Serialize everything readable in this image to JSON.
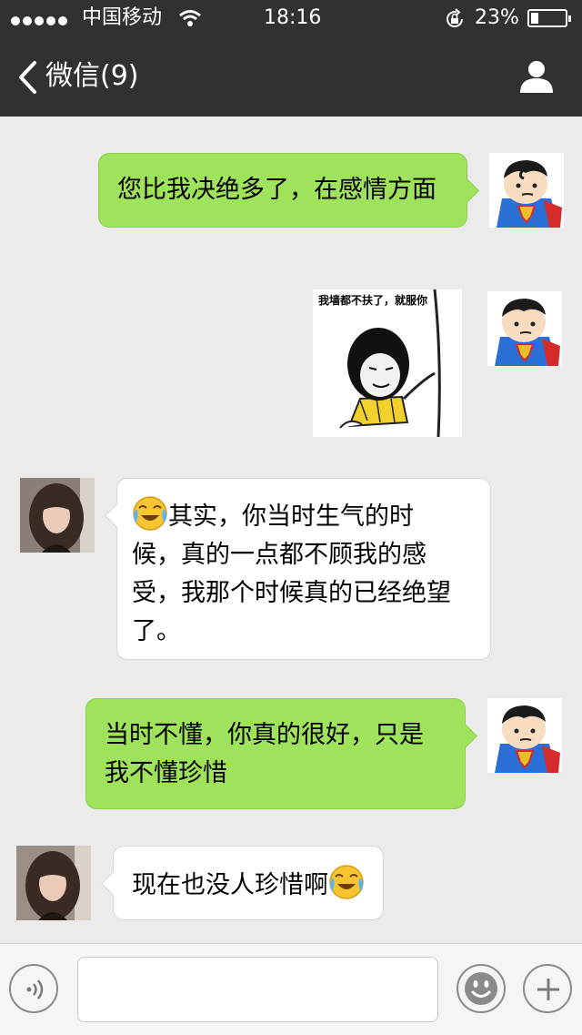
{
  "status_bar": {
    "carrier": "中国移动",
    "time": "18:16",
    "battery_percent": "23%",
    "battery_level": 0.23
  },
  "nav": {
    "back_label": "微信(9)",
    "profile_icon": "person-icon"
  },
  "messages": [
    {
      "side": "me",
      "type": "text",
      "text": "您比我决绝多了，在感情方面"
    },
    {
      "side": "me",
      "type": "sticker",
      "caption": "我墙都不扶了，就服你"
    },
    {
      "side": "them",
      "type": "text",
      "emoji": "crying-laughing-emoji",
      "text": "其实，你当时生气的时\n候，真的一点都不顾我的感\n受，我那个时候真的已经绝望\n了。"
    },
    {
      "side": "me",
      "type": "text",
      "text": "当时不懂，你真的很好，只是\n我不懂珍惜"
    },
    {
      "side": "them",
      "type": "text",
      "text": "现在也没人珍惜啊",
      "emoji": "crying-laughing-emoji"
    }
  ],
  "input_bar": {
    "voice_icon": "voice-icon",
    "emoji_icon": "smiley-icon",
    "more_icon": "plus-icon",
    "text_value": ""
  },
  "colors": {
    "nav_bg": "#2f3133",
    "chat_bg": "#ebebeb",
    "my_bubble": "#9fe35c",
    "their_bubble": "#ffffff"
  }
}
